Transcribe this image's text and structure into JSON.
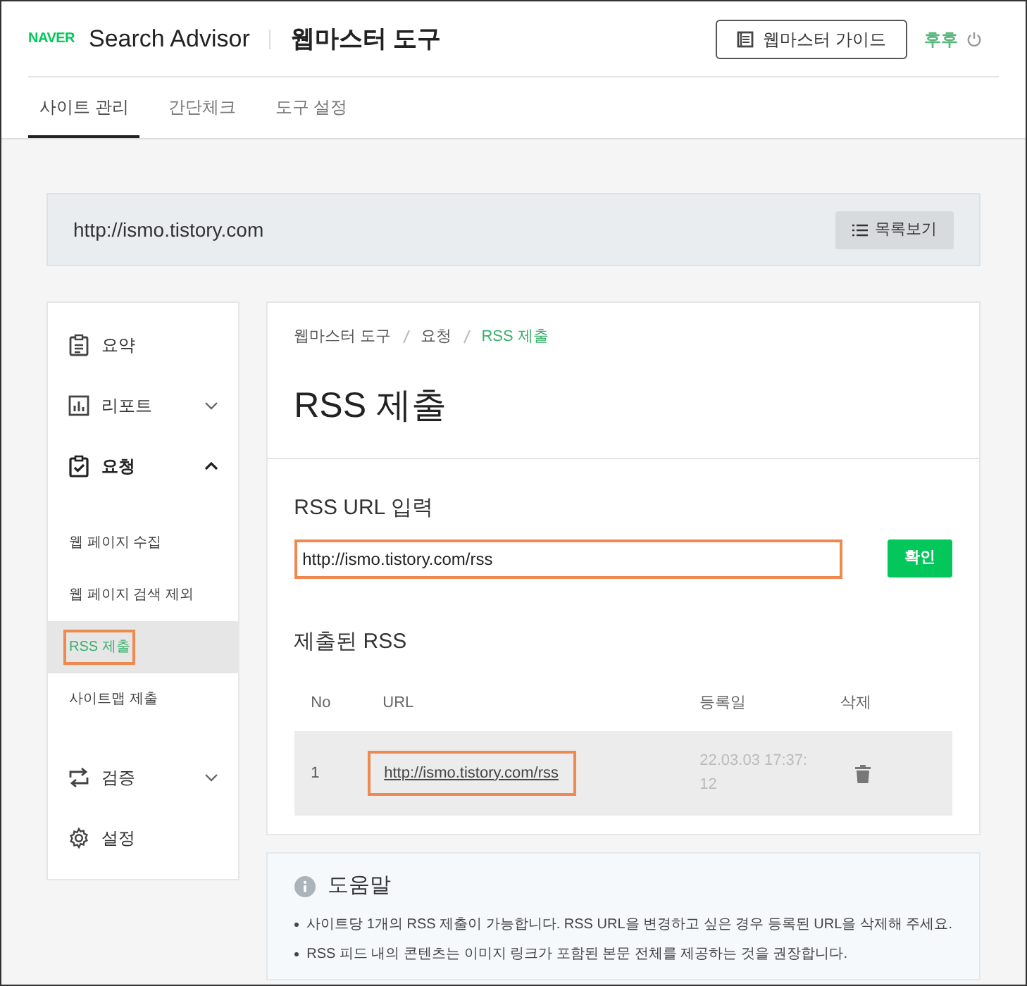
{
  "header": {
    "logo": "NAVER",
    "product": "Search Advisor",
    "title": "웹마스터 도구",
    "guide_button": "웹마스터 가이드",
    "user": "후후"
  },
  "tabs": [
    {
      "label": "사이트 관리",
      "selected": true
    },
    {
      "label": "간단체크",
      "selected": false
    },
    {
      "label": "도구 설정",
      "selected": false
    }
  ],
  "site_bar": {
    "url": "http://ismo.tistory.com",
    "list_button": "목록보기"
  },
  "sidebar": {
    "items": [
      {
        "label": "요약"
      },
      {
        "label": "리포트",
        "expanded": false
      },
      {
        "label": "요청",
        "expanded": true,
        "children": [
          {
            "label": "웹 페이지 수집",
            "selected": false,
            "highlighted": false
          },
          {
            "label": "웹 페이지 검색 제외",
            "selected": false,
            "highlighted": false
          },
          {
            "label": "RSS 제출",
            "selected": true,
            "highlighted": true
          },
          {
            "label": "사이트맵 제출",
            "selected": false,
            "highlighted": false
          }
        ]
      },
      {
        "label": "검증",
        "expanded": false
      },
      {
        "label": "설정"
      }
    ]
  },
  "main": {
    "breadcrumb": [
      "웹마스터 도구",
      "요청",
      "RSS 제출"
    ],
    "title": "RSS 제출",
    "url_input": {
      "label": "RSS URL 입력",
      "value": "http://ismo.tistory.com/rss",
      "highlighted": true,
      "button": "확인"
    },
    "submitted": {
      "title": "제출된 RSS",
      "columns": [
        "No",
        "URL",
        "등록일",
        "삭제"
      ],
      "rows": [
        {
          "no": "1",
          "url": "http://ismo.tistory.com/rss",
          "date": "22.03.03 17:37:12",
          "highlighted": true
        }
      ]
    }
  },
  "help": {
    "title": "도움말",
    "items": [
      "사이트당 1개의 RSS 제출이 가능합니다. RSS URL을 변경하고 싶은 경우 등록된 URL을 삭제해 주세요.",
      "RSS 피드 내의 콘텐츠는 이미지 링크가 포함된 본문 전체를 제공하는 것을 권장합니다."
    ]
  }
}
